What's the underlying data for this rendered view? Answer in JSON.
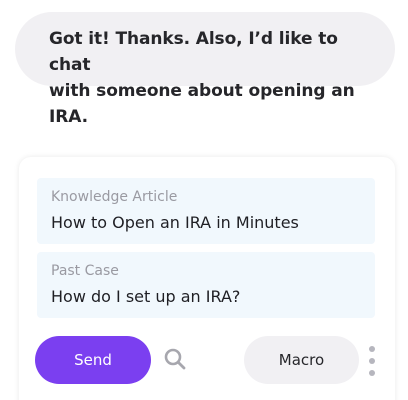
{
  "chat": {
    "message_line1": "Got it! Thanks. Also, I’d like to chat",
    "message_line2": "with someone about opening an IRA."
  },
  "suggestions": [
    {
      "label": "Knowledge Article",
      "text": "How to Open an IRA in Minutes"
    },
    {
      "label": "Past Case",
      "text": "How do I set up an IRA?"
    }
  ],
  "actions": {
    "send_label": "Send",
    "macro_label": "Macro",
    "search_icon": "search-icon",
    "more_icon": "more-vertical-icon"
  },
  "colors": {
    "accent": "#7b3ff0",
    "bubble_bg": "#f1f0f3",
    "suggestion_bg": "#f1f8fd"
  }
}
